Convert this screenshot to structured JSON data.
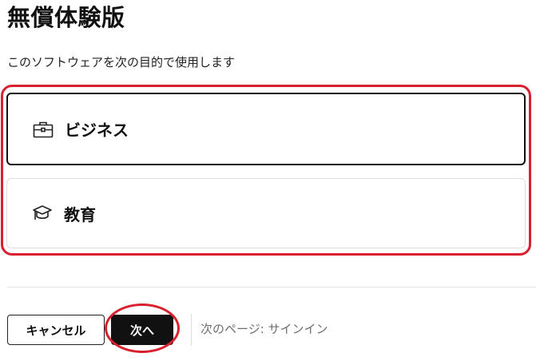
{
  "header": {
    "title": "無償体験版",
    "subtitle": "このソフトウェアを次の目的で使用します"
  },
  "options": [
    {
      "label": "ビジネス",
      "icon": "briefcase-icon",
      "selected": true
    },
    {
      "label": "教育",
      "icon": "graduation-cap-icon",
      "selected": false
    }
  ],
  "footer": {
    "cancel_label": "キャンセル",
    "next_label": "次へ",
    "next_page_text": "次のページ: サインイン"
  },
  "colors": {
    "annotation": "#d9202f",
    "primary_button": "#111111",
    "selected_border": "#111111"
  }
}
